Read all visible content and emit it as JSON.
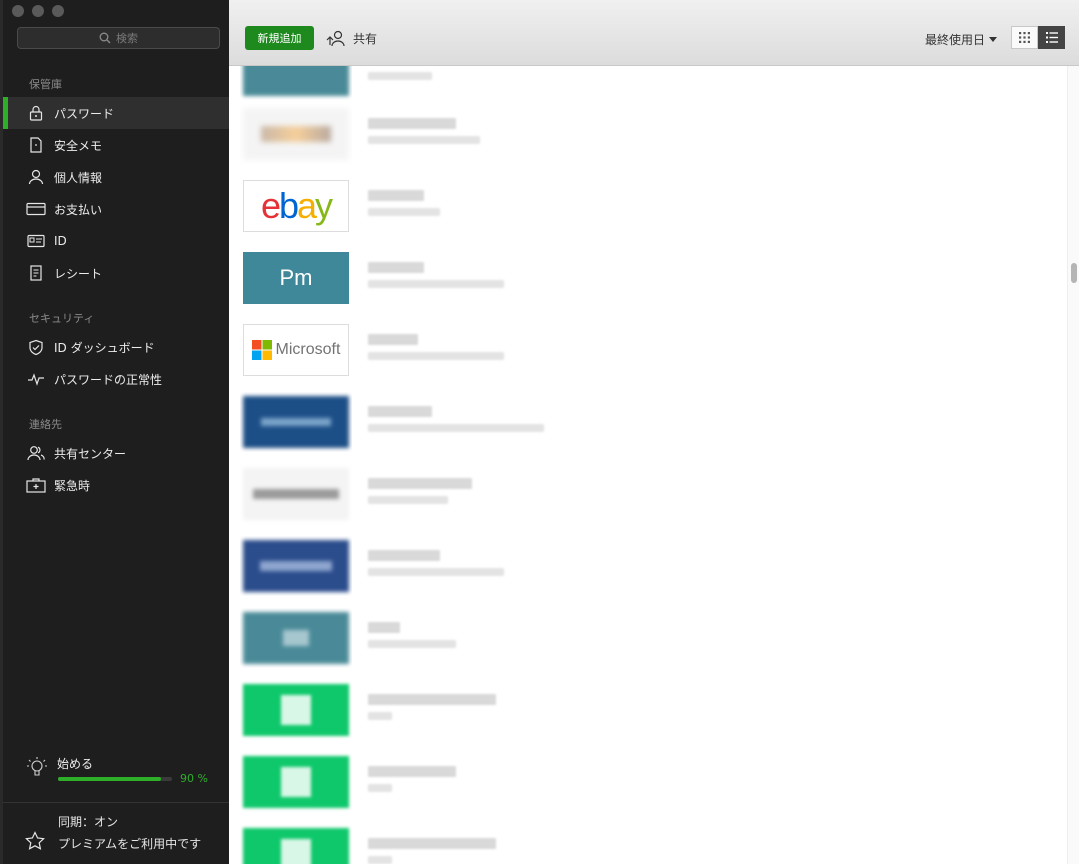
{
  "sidebar": {
    "search_placeholder": "検索",
    "sections": [
      {
        "heading": "保管庫",
        "items": [
          {
            "label": "パスワード",
            "icon": "lock-icon",
            "active": true
          },
          {
            "label": "安全メモ",
            "icon": "note-icon"
          },
          {
            "label": "個人情報",
            "icon": "person-icon"
          },
          {
            "label": "お支払い",
            "icon": "card-icon"
          },
          {
            "label": "ID",
            "icon": "id-card-icon"
          },
          {
            "label": "レシート",
            "icon": "receipt-icon"
          }
        ]
      },
      {
        "heading": "セキュリティ",
        "items": [
          {
            "label": "ID ダッシュボード",
            "icon": "shield-icon"
          },
          {
            "label": "パスワードの正常性",
            "icon": "pulse-icon"
          }
        ]
      },
      {
        "heading": "連絡先",
        "items": [
          {
            "label": "共有センター",
            "icon": "people-icon"
          },
          {
            "label": "緊急時",
            "icon": "first-aid-icon"
          }
        ]
      }
    ],
    "getting_started": {
      "label": "始める",
      "progress": 0.9,
      "percent_text": "90 %"
    },
    "sync_status": "同期：オン",
    "premium_text": "プレミアムをご利用中です"
  },
  "toolbar": {
    "add_new_label": "新規追加",
    "share_label": "共有",
    "sort_label": "最終使用日"
  },
  "entries": [
    {
      "logo": "blurred",
      "color": "#4a8a98"
    },
    {
      "logo": "blurred",
      "color": "#f4f4f4"
    },
    {
      "logo": "ebay",
      "text": "ebay"
    },
    {
      "logo": "pm",
      "text": "Pm",
      "color": "#3f8899"
    },
    {
      "logo": "microsoft",
      "text": "Microsoft"
    },
    {
      "logo": "blurred",
      "color": "#1d4f87"
    },
    {
      "logo": "blurred",
      "color": "#f4f4f4"
    },
    {
      "logo": "blurred",
      "color": "#2b4d8c"
    },
    {
      "logo": "blurred",
      "color": "#4a8a98"
    },
    {
      "logo": "blurred",
      "color": "#0fc86b"
    },
    {
      "logo": "blurred",
      "color": "#0fc86b"
    },
    {
      "logo": "blurred",
      "color": "#0fc86b"
    }
  ],
  "colors": {
    "accent": "#2fae2a",
    "add_button": "#1e8a1e"
  }
}
